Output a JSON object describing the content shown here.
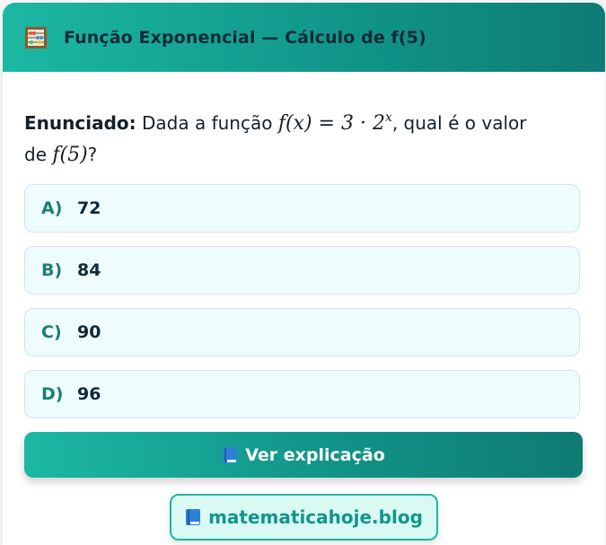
{
  "header": {
    "icon": "abacus-icon",
    "title": "Função Exponencial — Cálculo de f(5)"
  },
  "statement": {
    "label": "Enunciado:",
    "text_before": "Dada a função",
    "formula_lhs": "f(x) = 3 · 2",
    "formula_exp": "x",
    "text_after": ", qual é o valor",
    "text_line2": "de",
    "formula_2": "f(5)",
    "text_end": "?"
  },
  "options": [
    {
      "letter": "A)",
      "value": "72"
    },
    {
      "letter": "B)",
      "value": "84"
    },
    {
      "letter": "C)",
      "value": "90"
    },
    {
      "letter": "D)",
      "value": "96"
    }
  ],
  "explain_button": {
    "icon": "book-icon",
    "label": "Ver explicação"
  },
  "blog_link": {
    "icon": "book-icon",
    "label": "matematicahoje.blog"
  },
  "colors": {
    "accent": "#1cb8a3",
    "accent_dark": "#0e7c74",
    "option_bg": "#effcfe",
    "option_letter": "#1b7e72",
    "text_dark": "#102a38"
  }
}
